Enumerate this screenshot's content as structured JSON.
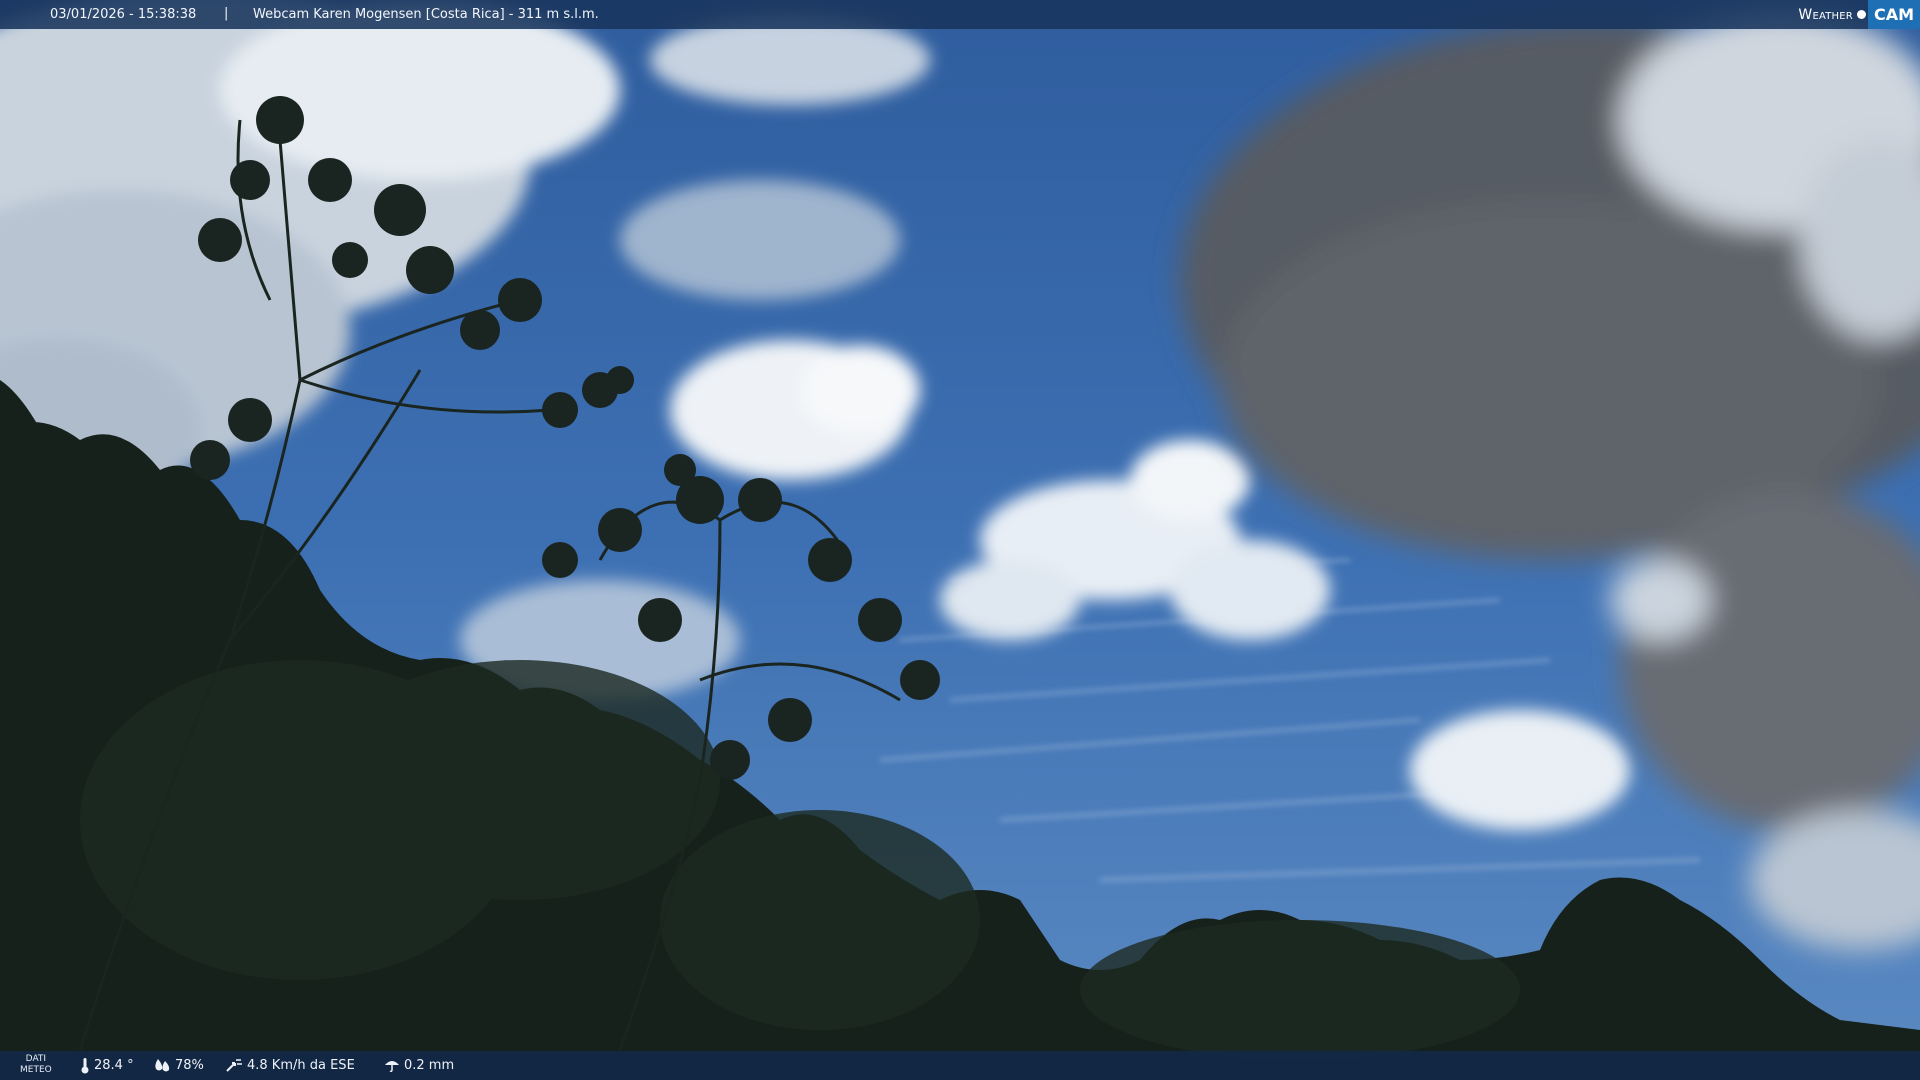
{
  "header": {
    "timestamp": "03/01/2026 - 15:38:38",
    "separator": "|",
    "title": "Webcam Karen Mogensen [Costa Rica]  - 311 m s.l.m."
  },
  "logo": {
    "weather_text": "Weather",
    "cam_text": "CAM"
  },
  "weather": {
    "label_line1": "DATI",
    "label_line2": "METEO",
    "temperature": "28.4 °",
    "humidity": "78%",
    "wind": "4.8 Km/h da ESE",
    "rain": "0.2 mm"
  }
}
